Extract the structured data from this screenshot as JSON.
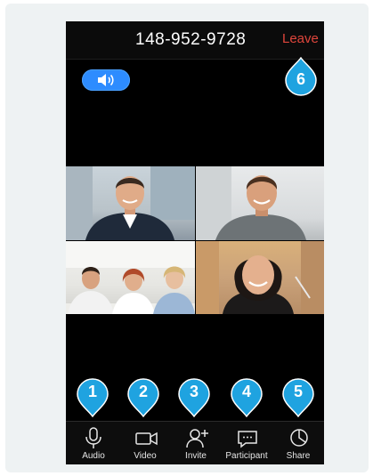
{
  "meeting": {
    "id": "148-952-9728",
    "leave_label": "Leave"
  },
  "colors": {
    "accent": "#2d8cff",
    "pin": "#1fa3e0",
    "leave": "#e0463c",
    "background": "#000000"
  },
  "audio_indicator": {
    "icon": "speaker-icon"
  },
  "participants_tiles": [
    {
      "icon": "participant-video"
    },
    {
      "icon": "participant-video"
    },
    {
      "icon": "participant-video"
    },
    {
      "icon": "participant-video"
    }
  ],
  "toolbar": {
    "items": [
      {
        "label": "Audio",
        "icon": "microphone-icon"
      },
      {
        "label": "Video",
        "icon": "video-camera-icon"
      },
      {
        "label": "Invite",
        "icon": "add-user-icon"
      },
      {
        "label": "Participant",
        "icon": "chat-icon"
      },
      {
        "label": "Share",
        "icon": "share-icon"
      }
    ]
  },
  "callouts": [
    "1",
    "2",
    "3",
    "4",
    "5",
    "6"
  ]
}
